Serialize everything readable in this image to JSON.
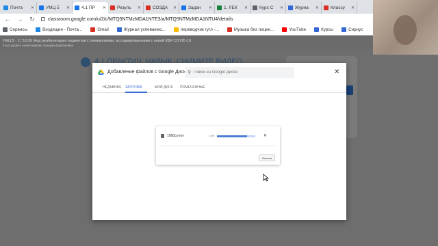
{
  "browser": {
    "tabs": [
      {
        "label": "Почта",
        "color": "#1e88e5",
        "active": false
      },
      {
        "label": "УМЦ 5",
        "color": "#1a73e8",
        "active": false
      },
      {
        "label": "4.1 ПР",
        "color": "#1a73e8",
        "active": true
      },
      {
        "label": "Резуль",
        "color": "#d93025",
        "active": false
      },
      {
        "label": "СОЗДА",
        "color": "#d93025",
        "active": false
      },
      {
        "label": "Задан",
        "color": "#1a73e8",
        "active": false
      },
      {
        "label": "1. ЛЕК",
        "color": "#188038",
        "active": false
      },
      {
        "label": "Курс С",
        "color": "#5f6368",
        "active": false
      },
      {
        "label": "Журна",
        "color": "#3367d6",
        "active": false
      },
      {
        "label": "Классу",
        "color": "#d93025",
        "active": false
      }
    ],
    "url": "classroom.google.com/u/2/c/MTQ5NTMzMDA1NTE3/a/MTQ5NTMzMDA1NTU4/details",
    "bookmarks": [
      {
        "label": "Сервисы",
        "color": "#5f6368"
      },
      {
        "label": "Входящие - Почта...",
        "color": "#1e88e5"
      },
      {
        "label": "Gmail",
        "color": "#d93025"
      },
      {
        "label": "Журнал успеваемо...",
        "color": "#3367d6"
      },
      {
        "label": "переводчик гугл -...",
        "color": "#fbbc04"
      },
      {
        "label": "Музыка без лицен...",
        "color": "#d93025"
      },
      {
        "label": "YouTube",
        "color": "#ff0000"
      },
      {
        "label": "Курсы",
        "color": "#3367d6"
      },
      {
        "label": "Сириус",
        "color": "#3367d6"
      }
    ]
  },
  "classroom": {
    "course_title": "УМЦ 5 - 17.10.20 Мед реабилитация пациентов с пневмониями, ассоциированными с новой КВИ COVID-19",
    "course_teacher": "К.м.н.доцент Александрова Эльвира Вартановна",
    "assignment_title": "4.1 ПРАКТИЧ. НАВЫК. СНИМИТЕ ВИДЕО"
  },
  "dialog": {
    "title": "Добавление файлов с Google Диска",
    "search_placeholder": "Поиск на Google Диске",
    "tabs": [
      "НЕДАВНИЕ",
      "ЗАГРУЗКА",
      "МОЙ ДИСК",
      "ПОМЕЧЕННЫЕ"
    ],
    "active_tab": "ЗАГРУЗКА",
    "upload": {
      "file_name": "1080p.mov",
      "file_size": "3 Мб",
      "progress": 0.78,
      "cancel_label": "Отмена"
    }
  }
}
